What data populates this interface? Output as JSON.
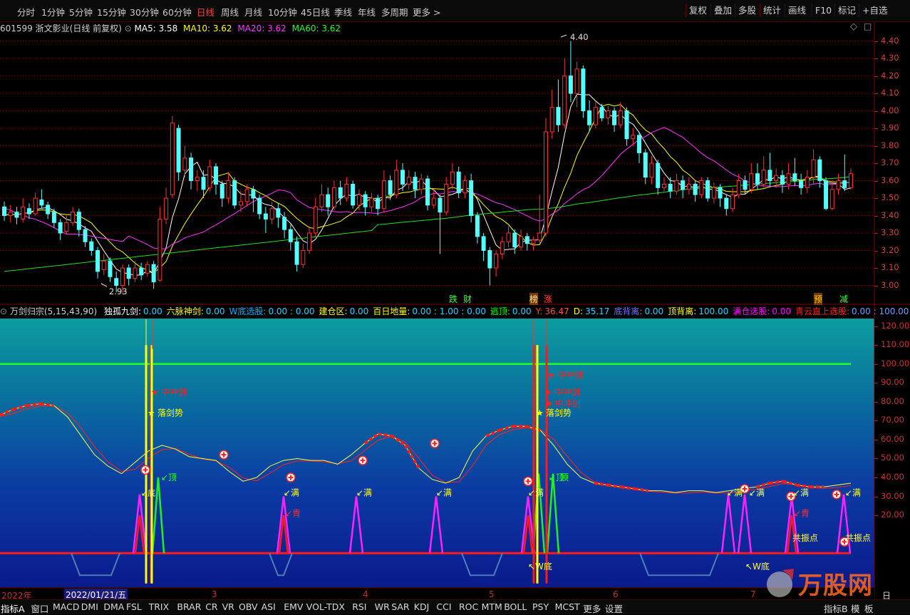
{
  "toolbar": {
    "periods": [
      "分时",
      "1分钟",
      "5分钟",
      "15分钟",
      "30分钟",
      "60分钟",
      "日线",
      "周线",
      "月线",
      "10分钟",
      "45日线",
      "季线",
      "年线",
      "多周期",
      "更多 >"
    ],
    "active_period": "日线",
    "tools": [
      "复权",
      "叠加",
      "多股",
      "统计",
      "画线",
      "F10",
      "标记",
      "+自选"
    ]
  },
  "price_panel": {
    "code": "601599",
    "name": "浙文影业(日线 前复权)",
    "ma5_label": "MA5: 3.58",
    "ma10_label": "MA10: 3.62",
    "ma20_label": "MA20: 3.62",
    "ma60_label": "MA60: 3.62",
    "high_label": "4.40",
    "low_label": "2.93",
    "signals": [
      "跌",
      "财",
      "榜",
      "涨",
      "预",
      "减"
    ],
    "colors": {
      "ma5": "#ffffff",
      "ma10": "#ffff00",
      "ma20": "#ff00ff",
      "ma60": "#00ff00",
      "up": "#ff3232",
      "down": "#54ffff"
    }
  },
  "indicator_panel": {
    "title": "万剑归宗(5,15,43,90)",
    "items": [
      {
        "label": "独孤九剑:",
        "value": "0.00",
        "color": "#ffffff"
      },
      {
        "label": "六脉神剑:",
        "value": "0.00",
        "color": "#ffff00"
      },
      {
        "label": "W底选股:",
        "value": "0.00 : 0.00",
        "color": "#00b0ff"
      },
      {
        "label": "建仓区:",
        "value": "0.00",
        "color": "#ffff00"
      },
      {
        "label": "百日地量:",
        "value": "0.00 : 1.00 : 0.00",
        "color": "#ffff00"
      },
      {
        "label": "逃顶:",
        "value": "0.00",
        "color": "#00ff00"
      },
      {
        "label": "Y:",
        "value": "36.47",
        "color": "#ff4040"
      },
      {
        "label": "D:",
        "value": "35.17",
        "color": "#ffff00"
      },
      {
        "label": "底背离:",
        "value": "0.00",
        "color": "#7070ff"
      },
      {
        "label": "顶背离:",
        "value": "100.00",
        "color": "#ffff00"
      },
      {
        "label": "满仓选股:",
        "value": "0.00",
        "color": "#ff00ff"
      },
      {
        "label": "青云直上选股:",
        "value": "0.00 : 100.00",
        "color": "#ff2020"
      }
    ],
    "annotations": {
      "cj": "中冲剑",
      "ljs": "落剑势",
      "ding": "顶",
      "di": "底",
      "man": "满",
      "qing": "青",
      "wdi": "W底",
      "gz": "共振点"
    }
  },
  "date_axis": {
    "year": "2022年",
    "cursor_date": "2022/01/21/五",
    "months": [
      "3",
      "4",
      "5",
      "6",
      "7"
    ],
    "right_label": "日线"
  },
  "bottom_tabs": [
    "指标A",
    "窗口",
    "MACD",
    "DMI",
    "DMA",
    "FSL",
    "TRIX",
    "BRAR",
    "CR",
    "VR",
    "OBV",
    "ASI",
    "EMV",
    "VOL-TDX",
    "RSI",
    "WR",
    "SAR",
    "KDJ",
    "CCI",
    "ROC",
    "MTM",
    "BOLL",
    "PSY",
    "MCST",
    "更多",
    "设置"
  ],
  "bottom_right": [
    "指标B",
    "模",
    "板"
  ],
  "watermark": "万股网",
  "chart_data": [
    {
      "type": "candlestick",
      "title": "601599 浙文影业(日线 前复权)",
      "y_axis_ticks": [
        3.0,
        3.1,
        3.2,
        3.3,
        3.4,
        3.5,
        3.6,
        3.7,
        3.8,
        3.9,
        4.0,
        4.1,
        4.2,
        4.3,
        4.4
      ],
      "ylim": [
        2.9,
        4.48
      ],
      "max_price": 4.4,
      "min_price": 2.93,
      "series": [
        {
          "name": "MA5",
          "last": 3.58
        },
        {
          "name": "MA10",
          "last": 3.62
        },
        {
          "name": "MA20",
          "last": 3.62
        },
        {
          "name": "MA60",
          "last": 3.62
        }
      ],
      "candles": [
        [
          3.45,
          3.4,
          3.48,
          3.37
        ],
        [
          3.4,
          3.42,
          3.46,
          3.36
        ],
        [
          3.42,
          3.39,
          3.45,
          3.35
        ],
        [
          3.38,
          3.45,
          3.5,
          3.36
        ],
        [
          3.44,
          3.41,
          3.47,
          3.38
        ],
        [
          3.41,
          3.5,
          3.53,
          3.4
        ],
        [
          3.49,
          3.46,
          3.55,
          3.44
        ],
        [
          3.46,
          3.41,
          3.48,
          3.38
        ],
        [
          3.42,
          3.36,
          3.44,
          3.33
        ],
        [
          3.36,
          3.3,
          3.38,
          3.26
        ],
        [
          3.31,
          3.36,
          3.4,
          3.29
        ],
        [
          3.36,
          3.42,
          3.45,
          3.34
        ],
        [
          3.42,
          3.32,
          3.44,
          3.28
        ],
        [
          3.32,
          3.25,
          3.34,
          3.22
        ],
        [
          3.25,
          3.2,
          3.27,
          3.17
        ],
        [
          3.2,
          3.08,
          3.22,
          3.04
        ],
        [
          3.09,
          3.14,
          3.18,
          3.06
        ],
        [
          3.14,
          3.05,
          3.16,
          3.02
        ],
        [
          3.04,
          3.0,
          3.08,
          2.96
        ],
        [
          3.0,
          3.1,
          3.12,
          2.95
        ],
        [
          3.1,
          3.04,
          3.12,
          3.0
        ],
        [
          3.04,
          3.1,
          3.14,
          3.02
        ],
        [
          3.1,
          3.06,
          3.13,
          3.03
        ],
        [
          3.07,
          3.12,
          3.14,
          3.05
        ],
        [
          3.12,
          3.02,
          3.14,
          2.98
        ],
        [
          3.03,
          3.38,
          3.45,
          3.02
        ],
        [
          3.38,
          3.5,
          3.56,
          3.35
        ],
        [
          3.52,
          3.93,
          3.97,
          3.5
        ],
        [
          3.9,
          3.65,
          3.92,
          3.6
        ],
        [
          3.66,
          3.73,
          3.8,
          3.62
        ],
        [
          3.73,
          3.6,
          3.76,
          3.55
        ],
        [
          3.6,
          3.62,
          3.66,
          3.54
        ],
        [
          3.62,
          3.55,
          3.66,
          3.5
        ],
        [
          3.56,
          3.68,
          3.72,
          3.54
        ],
        [
          3.68,
          3.58,
          3.7,
          3.52
        ],
        [
          3.58,
          3.5,
          3.6,
          3.45
        ],
        [
          3.5,
          3.6,
          3.65,
          3.47
        ],
        [
          3.6,
          3.46,
          3.62,
          3.44
        ],
        [
          3.46,
          3.48,
          3.54,
          3.42
        ],
        [
          3.48,
          3.55,
          3.58,
          3.45
        ],
        [
          3.55,
          3.5,
          3.57,
          3.42
        ],
        [
          3.5,
          3.41,
          3.52,
          3.38
        ],
        [
          3.41,
          3.38,
          3.45,
          3.3
        ],
        [
          3.38,
          3.44,
          3.48,
          3.35
        ],
        [
          3.44,
          3.39,
          3.47,
          3.33
        ],
        [
          3.39,
          3.32,
          3.42,
          3.27
        ],
        [
          3.32,
          3.25,
          3.35,
          3.2
        ],
        [
          3.25,
          3.12,
          3.28,
          3.08
        ],
        [
          3.12,
          3.2,
          3.24,
          3.1
        ],
        [
          3.2,
          3.3,
          3.34,
          3.18
        ],
        [
          3.3,
          3.45,
          3.5,
          3.28
        ],
        [
          3.45,
          3.52,
          3.58,
          3.42
        ],
        [
          3.52,
          3.45,
          3.56,
          3.4
        ],
        [
          3.45,
          3.56,
          3.6,
          3.43
        ],
        [
          3.56,
          3.5,
          3.6,
          3.46
        ],
        [
          3.5,
          3.58,
          3.62,
          3.48
        ],
        [
          3.58,
          3.46,
          3.6,
          3.44
        ],
        [
          3.46,
          3.52,
          3.55,
          3.43
        ],
        [
          3.52,
          3.45,
          3.54,
          3.4
        ],
        [
          3.45,
          3.5,
          3.53,
          3.42
        ],
        [
          3.5,
          3.44,
          3.52,
          3.4
        ],
        [
          3.44,
          3.6,
          3.66,
          3.42
        ],
        [
          3.6,
          3.52,
          3.63,
          3.49
        ],
        [
          3.52,
          3.66,
          3.72,
          3.5
        ],
        [
          3.66,
          3.58,
          3.7,
          3.54
        ],
        [
          3.58,
          3.62,
          3.66,
          3.55
        ],
        [
          3.62,
          3.55,
          3.65,
          3.5
        ],
        [
          3.55,
          3.61,
          3.64,
          3.52
        ],
        [
          3.61,
          3.46,
          3.63,
          3.43
        ],
        [
          3.46,
          3.5,
          3.55,
          3.44
        ],
        [
          3.5,
          3.42,
          3.52,
          3.18
        ],
        [
          3.42,
          3.58,
          3.62,
          3.4
        ],
        [
          3.58,
          3.65,
          3.7,
          3.55
        ],
        [
          3.65,
          3.53,
          3.68,
          3.5
        ],
        [
          3.53,
          3.6,
          3.63,
          3.5
        ],
        [
          3.6,
          3.4,
          3.64,
          3.36
        ],
        [
          3.4,
          3.28,
          3.42,
          3.24
        ],
        [
          3.28,
          3.2,
          3.3,
          3.14
        ],
        [
          3.2,
          3.1,
          3.22,
          3.0
        ],
        [
          3.1,
          3.18,
          3.2,
          3.05
        ],
        [
          3.18,
          3.25,
          3.28,
          3.15
        ],
        [
          3.25,
          3.3,
          3.34,
          3.22
        ],
        [
          3.3,
          3.22,
          3.32,
          3.18
        ],
        [
          3.22,
          3.28,
          3.32,
          3.2
        ],
        [
          3.28,
          3.24,
          3.3,
          3.2
        ],
        [
          3.24,
          3.26,
          3.28,
          3.2
        ],
        [
          3.26,
          3.3,
          3.52,
          3.24
        ],
        [
          3.3,
          3.88,
          3.96,
          3.28
        ],
        [
          3.88,
          4.02,
          4.12,
          3.84
        ],
        [
          4.02,
          3.92,
          4.18,
          3.88
        ],
        [
          3.92,
          4.2,
          4.3,
          3.9
        ],
        [
          4.2,
          4.1,
          4.4,
          4.05
        ],
        [
          4.1,
          4.24,
          4.28,
          4.02
        ],
        [
          4.24,
          4.0,
          4.26,
          3.96
        ],
        [
          4.0,
          3.92,
          4.06,
          3.88
        ],
        [
          3.92,
          4.02,
          4.05,
          3.9
        ],
        [
          4.02,
          3.96,
          4.04,
          3.94
        ],
        [
          3.96,
          4.0,
          4.03,
          3.92
        ],
        [
          4.0,
          3.92,
          4.02,
          3.88
        ],
        [
          3.92,
          4.0,
          4.05,
          3.9
        ],
        [
          4.0,
          3.84,
          4.02,
          3.8
        ],
        [
          3.84,
          3.86,
          3.9,
          3.8
        ],
        [
          3.86,
          3.76,
          3.88,
          3.7
        ],
        [
          3.76,
          3.62,
          3.78,
          3.58
        ],
        [
          3.62,
          3.7,
          3.74,
          3.58
        ],
        [
          3.7,
          3.56,
          3.72,
          3.52
        ],
        [
          3.56,
          3.58,
          3.62,
          3.54
        ],
        [
          3.58,
          3.54,
          3.62,
          3.5
        ],
        [
          3.54,
          3.6,
          3.64,
          3.52
        ],
        [
          3.6,
          3.55,
          3.63,
          3.5
        ],
        [
          3.55,
          3.58,
          3.62,
          3.52
        ],
        [
          3.58,
          3.52,
          3.6,
          3.48
        ],
        [
          3.52,
          3.6,
          3.62,
          3.5
        ],
        [
          3.6,
          3.5,
          3.62,
          3.48
        ],
        [
          3.5,
          3.56,
          3.59,
          3.47
        ],
        [
          3.56,
          3.5,
          3.58,
          3.45
        ],
        [
          3.5,
          3.44,
          3.52,
          3.4
        ],
        [
          3.44,
          3.52,
          3.56,
          3.42
        ],
        [
          3.52,
          3.6,
          3.64,
          3.5
        ],
        [
          3.6,
          3.55,
          3.63,
          3.52
        ],
        [
          3.55,
          3.64,
          3.7,
          3.53
        ],
        [
          3.64,
          3.58,
          3.7,
          3.55
        ],
        [
          3.58,
          3.66,
          3.74,
          3.56
        ],
        [
          3.66,
          3.6,
          3.76,
          3.57
        ],
        [
          3.6,
          3.63,
          3.67,
          3.56
        ],
        [
          3.63,
          3.58,
          3.66,
          3.53
        ],
        [
          3.58,
          3.64,
          3.7,
          3.55
        ],
        [
          3.64,
          3.6,
          3.73,
          3.57
        ],
        [
          3.6,
          3.56,
          3.64,
          3.52
        ],
        [
          3.56,
          3.62,
          3.66,
          3.53
        ],
        [
          3.62,
          3.72,
          3.78,
          3.58
        ],
        [
          3.72,
          3.6,
          3.74,
          3.56
        ],
        [
          3.6,
          3.44,
          3.62,
          3.43
        ],
        [
          3.44,
          3.55,
          3.6,
          3.43
        ],
        [
          3.55,
          3.6,
          3.64,
          3.52
        ],
        [
          3.6,
          3.56,
          3.75,
          3.54
        ],
        [
          3.56,
          3.64,
          3.67,
          3.55
        ]
      ]
    },
    {
      "type": "line",
      "title": "万剑归宗(5,15,43,90)",
      "y_axis_ticks": [
        20,
        30,
        40,
        50,
        60,
        70,
        80,
        90,
        100,
        110,
        120
      ],
      "ylim": [
        -18,
        124
      ],
      "reference_line": 100,
      "series": [
        {
          "name": "Y",
          "last": 36.47,
          "values": [
            73,
            76,
            78,
            79,
            78,
            72,
            62,
            52,
            46,
            42,
            48,
            54,
            57,
            55,
            51,
            50,
            49,
            43,
            38,
            40,
            46,
            49,
            50,
            49,
            49,
            47,
            52,
            58,
            63,
            62,
            57,
            45,
            39,
            37,
            40,
            54,
            62,
            65,
            67,
            67,
            65,
            57,
            47,
            40,
            37,
            36,
            35,
            34,
            33,
            33,
            32,
            33,
            33,
            32,
            33,
            34,
            35,
            37,
            38,
            36,
            35,
            35,
            36,
            37
          ]
        },
        {
          "name": "D",
          "last": 35.17
        }
      ]
    }
  ]
}
